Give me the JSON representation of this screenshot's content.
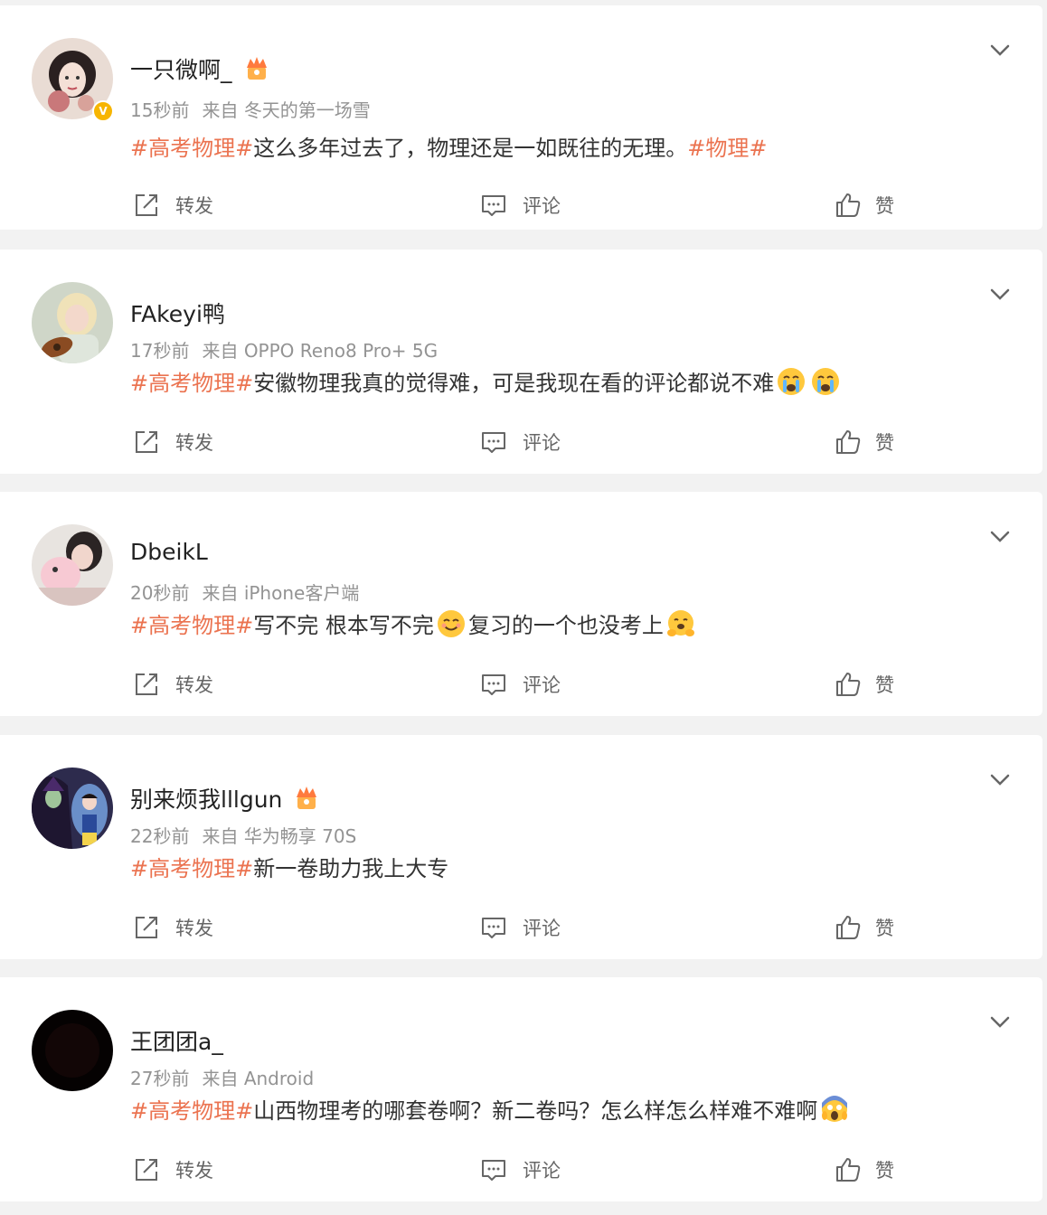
{
  "actions": {
    "share_label": "转发",
    "comment_label": "评论",
    "like_label": "赞"
  },
  "colors": {
    "tag": "#eb7350",
    "meta": "#939393",
    "verified": "#f7b500",
    "background": "#f2f2f2"
  },
  "posts": [
    {
      "username": "一只微啊_",
      "time": "15秒前",
      "source_prefix": "来自",
      "source": "冬天的第一场雪",
      "tag": "#高考物理#",
      "text": "这么多年过去了，物理还是一如既往的无理。",
      "tag2": "#物理#",
      "verified": true,
      "crown": true,
      "emojis": []
    },
    {
      "username": "FAkeyi鸭",
      "time": "17秒前",
      "source_prefix": "来自",
      "source": "OPPO Reno8 Pro+ 5G",
      "tag": "#高考物理#",
      "text": "安徽物理我真的觉得难，可是我现在看的评论都说不难",
      "verified": false,
      "crown": false,
      "emojis": [
        "crying-emoji",
        "crying-emoji"
      ]
    },
    {
      "username": "DbeikL",
      "time": "20秒前",
      "source_prefix": "来自",
      "source": "iPhone客户端",
      "tag": "#高考物理#",
      "text": "写不完 根本写不完",
      "text2": "复习的一个也没考上",
      "verified": false,
      "crown": false,
      "emojis": [
        "smiling-emoji",
        "hugging-emoji"
      ]
    },
    {
      "username": "别来烦我lllgun",
      "time": "22秒前",
      "source_prefix": "来自",
      "source": "华为畅享 70S",
      "tag": "#高考物理#",
      "text": "新一卷助力我上大专",
      "verified": false,
      "crown": true,
      "emojis": []
    },
    {
      "username": "王团团a_",
      "time": "27秒前",
      "source_prefix": "来自",
      "source": "Android",
      "tag": "#高考物理#",
      "text": "山西物理考的哪套卷啊？新二卷吗？怎么样怎么样难不难啊",
      "verified": false,
      "crown": false,
      "emojis": [
        "screaming-emoji"
      ]
    }
  ]
}
